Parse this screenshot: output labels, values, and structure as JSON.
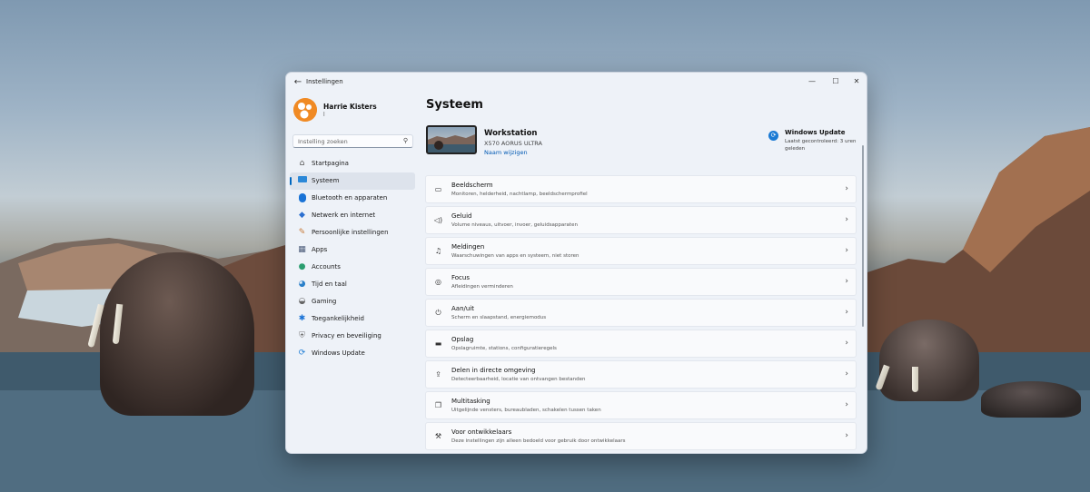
{
  "window": {
    "title": "Instellingen",
    "back_icon": "back-arrow-icon",
    "controls": {
      "minimize": "—",
      "maximize": "☐",
      "close": "✕"
    }
  },
  "user": {
    "name": "Harrie Kisters",
    "subtitle": "l"
  },
  "search": {
    "placeholder": "Instelling zoeken",
    "icon": "search-icon"
  },
  "sidebar": {
    "items": [
      {
        "label": "Startpagina",
        "icon": "home-icon",
        "active": false
      },
      {
        "label": "Systeem",
        "icon": "monitor-icon",
        "active": true
      },
      {
        "label": "Bluetooth en apparaten",
        "icon": "bluetooth-icon",
        "active": false
      },
      {
        "label": "Netwerk en internet",
        "icon": "wifi-icon",
        "active": false
      },
      {
        "label": "Persoonlijke instellingen",
        "icon": "brush-icon",
        "active": false
      },
      {
        "label": "Apps",
        "icon": "apps-icon",
        "active": false
      },
      {
        "label": "Accounts",
        "icon": "account-icon",
        "active": false
      },
      {
        "label": "Tijd en taal",
        "icon": "globe-clock-icon",
        "active": false
      },
      {
        "label": "Gaming",
        "icon": "gamepad-icon",
        "active": false
      },
      {
        "label": "Toegankelijkheid",
        "icon": "accessibility-icon",
        "active": false
      },
      {
        "label": "Privacy en beveiliging",
        "icon": "shield-icon",
        "active": false
      },
      {
        "label": "Windows Update",
        "icon": "update-icon",
        "active": false
      }
    ]
  },
  "main": {
    "title": "Systeem",
    "device": {
      "name": "Workstation",
      "model": "X570 AORUS ULTRA",
      "rename_label": "Naam wijzigen"
    },
    "windows_update": {
      "title": "Windows Update",
      "subtitle": "Laatst gecontroleerd: 3 uren geleden"
    },
    "cards": [
      {
        "title": "Beeldscherm",
        "subtitle": "Monitoren, helderheid, nachtlamp, beeldschermprofiel",
        "icon": "display-icon"
      },
      {
        "title": "Geluid",
        "subtitle": "Volume niveaus, uitvoer, invoer, geluidsapparaten",
        "icon": "speaker-icon"
      },
      {
        "title": "Meldingen",
        "subtitle": "Waarschuwingen van apps en systeem, niet storen",
        "icon": "bell-icon"
      },
      {
        "title": "Focus",
        "subtitle": "Afleidingen verminderen",
        "icon": "focus-icon"
      },
      {
        "title": "Aan/uit",
        "subtitle": "Scherm en slaapstand, energiemodus",
        "icon": "power-icon"
      },
      {
        "title": "Opslag",
        "subtitle": "Opslagruimte, stations, configuratieregels",
        "icon": "storage-icon"
      },
      {
        "title": "Delen in directe omgeving",
        "subtitle": "Detecteerbaarheid, locatie van ontvangen bestanden",
        "icon": "share-icon"
      },
      {
        "title": "Multitasking",
        "subtitle": "Uitgelijnde vensters, bureaubladen, schakelen tussen taken",
        "icon": "multitask-icon"
      },
      {
        "title": "Voor ontwikkelaars",
        "subtitle": "Deze instellingen zijn alleen bedoeld voor gebruik door ontwikkelaars",
        "icon": "developer-icon"
      }
    ]
  },
  "colors": {
    "accent": "#0067c0",
    "window_bg": "#eef2f8",
    "card_bg": "#f9fafc"
  }
}
